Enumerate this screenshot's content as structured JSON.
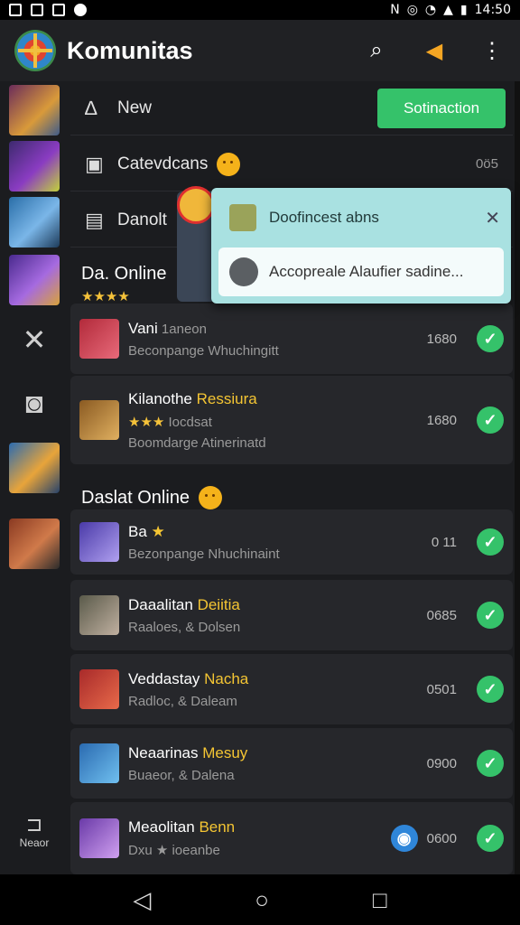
{
  "status_bar": {
    "time": "14:50"
  },
  "app_bar": {
    "title": "Komunitas",
    "search_icon": "search-icon",
    "megaphone_icon": "megaphone-icon",
    "menu_icon": "more-vert-icon"
  },
  "top_rows": {
    "new": {
      "label": "New",
      "button_label": "Sotinaction"
    },
    "categories": {
      "label": "Catevdcans",
      "count": "0ö5"
    },
    "danolt": {
      "label": "Danolt"
    }
  },
  "section1": {
    "title": "Da. Online"
  },
  "section2": {
    "title": "Daslat Online"
  },
  "cards": [
    {
      "title": "Vani",
      "title_tail": " 1aneon",
      "sub": "Beconpange Whuchingitt",
      "count": "1680"
    },
    {
      "title": "Kilanothe ",
      "title_hl": "Ressiura",
      "stars": "★★★",
      "sub_tail": " Iocdsat",
      "sub": "Boomdarge Atinerinatd",
      "count": "1680"
    },
    {
      "title": "Ba",
      "title_tail": " ★",
      "sub": "Bezonpange Nhuchinaint",
      "count": "0 11"
    },
    {
      "title": "Daaalitan ",
      "title_hl": "Deiitia",
      "sub": "Raaloes, & Dolsen",
      "count": "0685"
    },
    {
      "title": "Veddastay ",
      "title_hl": "Nacha",
      "sub": "Radloc, & Daleam",
      "count": "0501"
    },
    {
      "title": "Neaarinas ",
      "title_hl": "Mesuy",
      "sub": "Buaeor, & Dalena",
      "count": "0900"
    },
    {
      "title": "Meaolitan ",
      "title_hl": "Benn",
      "sub": "Dxu ★ ioeanbe",
      "count": "0600"
    }
  ],
  "popup": {
    "title": "Doofincest abns",
    "field": "Accopreale Alaufier sadine..."
  },
  "rail": {
    "bottom_label": "Neaor"
  },
  "nav": {
    "back": "◁",
    "home": "○",
    "recents": "□"
  },
  "colors": {
    "accent": "#35c26a",
    "background": "#1b1c1f",
    "popup": "#a9e1e1"
  }
}
